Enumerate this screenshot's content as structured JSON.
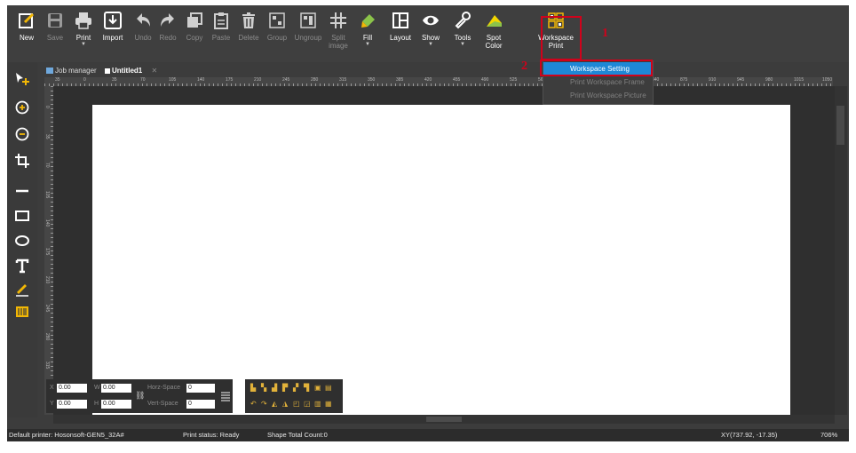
{
  "toolbar": {
    "new": "New",
    "save": "Save",
    "print": "Print",
    "import": "Import",
    "undo": "Undo",
    "redo": "Redo",
    "copy": "Copy",
    "paste": "Paste",
    "delete": "Delete",
    "group": "Group",
    "ungroup": "Ungroup",
    "split_line1": "Split",
    "split_line2": "image",
    "fill": "Fill",
    "layout": "Layout",
    "show": "Show",
    "tools": "Tools",
    "spot_line1": "Spot",
    "spot_line2": "Color",
    "workspace_line1": "Workspace",
    "workspace_line2": "Print"
  },
  "annotations": {
    "one": "1",
    "two": "2"
  },
  "dropdown": {
    "items": [
      "Workspace Setting",
      "Print Workspace Frame",
      "Print Workspace Picture"
    ]
  },
  "tabs": [
    "Job manager",
    "Untitled1"
  ],
  "ruler": {
    "horizontal": [
      "35",
      "0",
      "35",
      "70",
      "105",
      "140",
      "175",
      "210",
      "245",
      "280",
      "315",
      "350",
      "385",
      "420",
      "455",
      "490",
      "525",
      "560",
      "595",
      "630",
      "805",
      "840",
      "875",
      "910",
      "945",
      "980",
      "1015",
      "1050"
    ],
    "vertical": [
      "0",
      "35",
      "70",
      "105",
      "140",
      "175",
      "210",
      "245",
      "280",
      "315",
      "350"
    ]
  },
  "position": {
    "x_label": "X",
    "x_value": "0.00",
    "w_label": "W",
    "w_value": "0.00",
    "y_label": "Y",
    "y_value": "0.00",
    "h_label": "H",
    "h_value": "0.00",
    "hspace_label": "Horz-Space",
    "hspace_value": "0",
    "vspace_label": "Vert-Space",
    "vspace_value": "0"
  },
  "status": {
    "printer": "Default printer: Hosonsoft-GEN5_32A#",
    "print_status": "Print status: Ready",
    "shape_count": "Shape Total Count:0",
    "coords": "XY(737.92, -17.35)",
    "zoom": "706%"
  },
  "colors": {
    "highlight": "#d0021b",
    "accent": "#1e88d6",
    "icon_yellow": "#e2b23a"
  }
}
